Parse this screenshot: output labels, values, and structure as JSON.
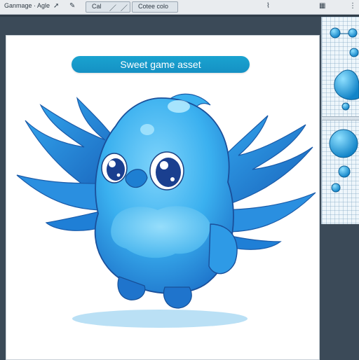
{
  "toolbar": {
    "title": "Ganmage · Agle",
    "mode": "Cal",
    "color_label": "Cotee colo"
  },
  "canvas": {
    "banner": "Sweet game asset"
  },
  "colors": {
    "accent": "#1591c4",
    "bird_body": "#3ab0ef",
    "bird_wing": "#1f7fd6",
    "shadow": "#a9d8f3"
  }
}
